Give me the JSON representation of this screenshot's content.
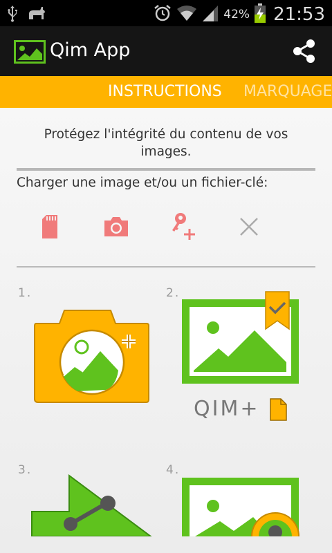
{
  "status_bar": {
    "battery_percent": "42%",
    "time": "21:53"
  },
  "app_bar": {
    "title": "Qim App"
  },
  "tabs": [
    {
      "label": "INSTRUCTIONS",
      "active": true
    },
    {
      "label": "MARQUAGE",
      "active": false
    }
  ],
  "main": {
    "intro_text": "Protégez l'intégrité du contenu de vos images.",
    "load_label": "Charger une image et/ou un fichier-clé:",
    "toolbar_icons": [
      "sd-card-icon",
      "camera-icon",
      "add-key-icon",
      "clear-icon"
    ],
    "steps": [
      {
        "number": "1.",
        "icon": "camera-add-image"
      },
      {
        "number": "2.",
        "icon": "image-watermark",
        "caption": "QIM+"
      },
      {
        "number": "3.",
        "icon": "share-arrow"
      },
      {
        "number": "4.",
        "icon": "image-verify"
      }
    ]
  },
  "colors": {
    "accent": "#ffb300",
    "action_bar": "#151515",
    "status_bar": "#000000",
    "icon_pink": "#f07a7a",
    "green": "#5fc21e",
    "green_border": "#4ab515"
  }
}
